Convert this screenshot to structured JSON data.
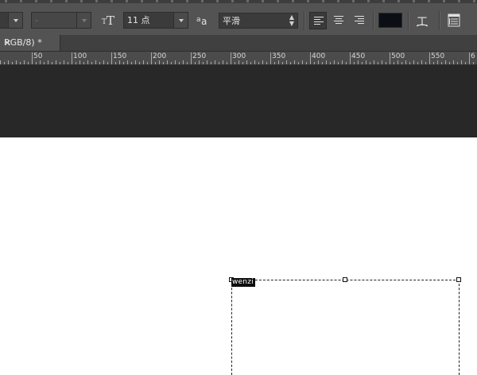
{
  "options_bar": {
    "font_style_value": "-",
    "font_size_value": "11 点",
    "antialias_value": "平滑",
    "text_color": "#0b0f15",
    "icons": {
      "font_size": "font-size-icon",
      "antialias": "antialias-icon",
      "align_left": "align-left-icon",
      "align_center": "align-center-icon",
      "align_right": "align-right-icon",
      "warp": "warp-text-icon",
      "panels": "character-paragraph-panel-icon"
    },
    "font_size_glyph": "T",
    "antialias_glyph": "a",
    "warp_glyph": "工"
  },
  "document_tab": {
    "label": "RGB/8) *",
    "close": "×"
  },
  "ruler": {
    "labels": [
      "50",
      "100",
      "150",
      "200",
      "250",
      "300",
      "350",
      "400",
      "450",
      "500",
      "550",
      "6"
    ]
  },
  "text_layer": {
    "selected_text": "wenzi"
  },
  "colors": {
    "panel_bg": "#535353",
    "pasteboard": "#282828",
    "canvas": "#ffffff"
  }
}
